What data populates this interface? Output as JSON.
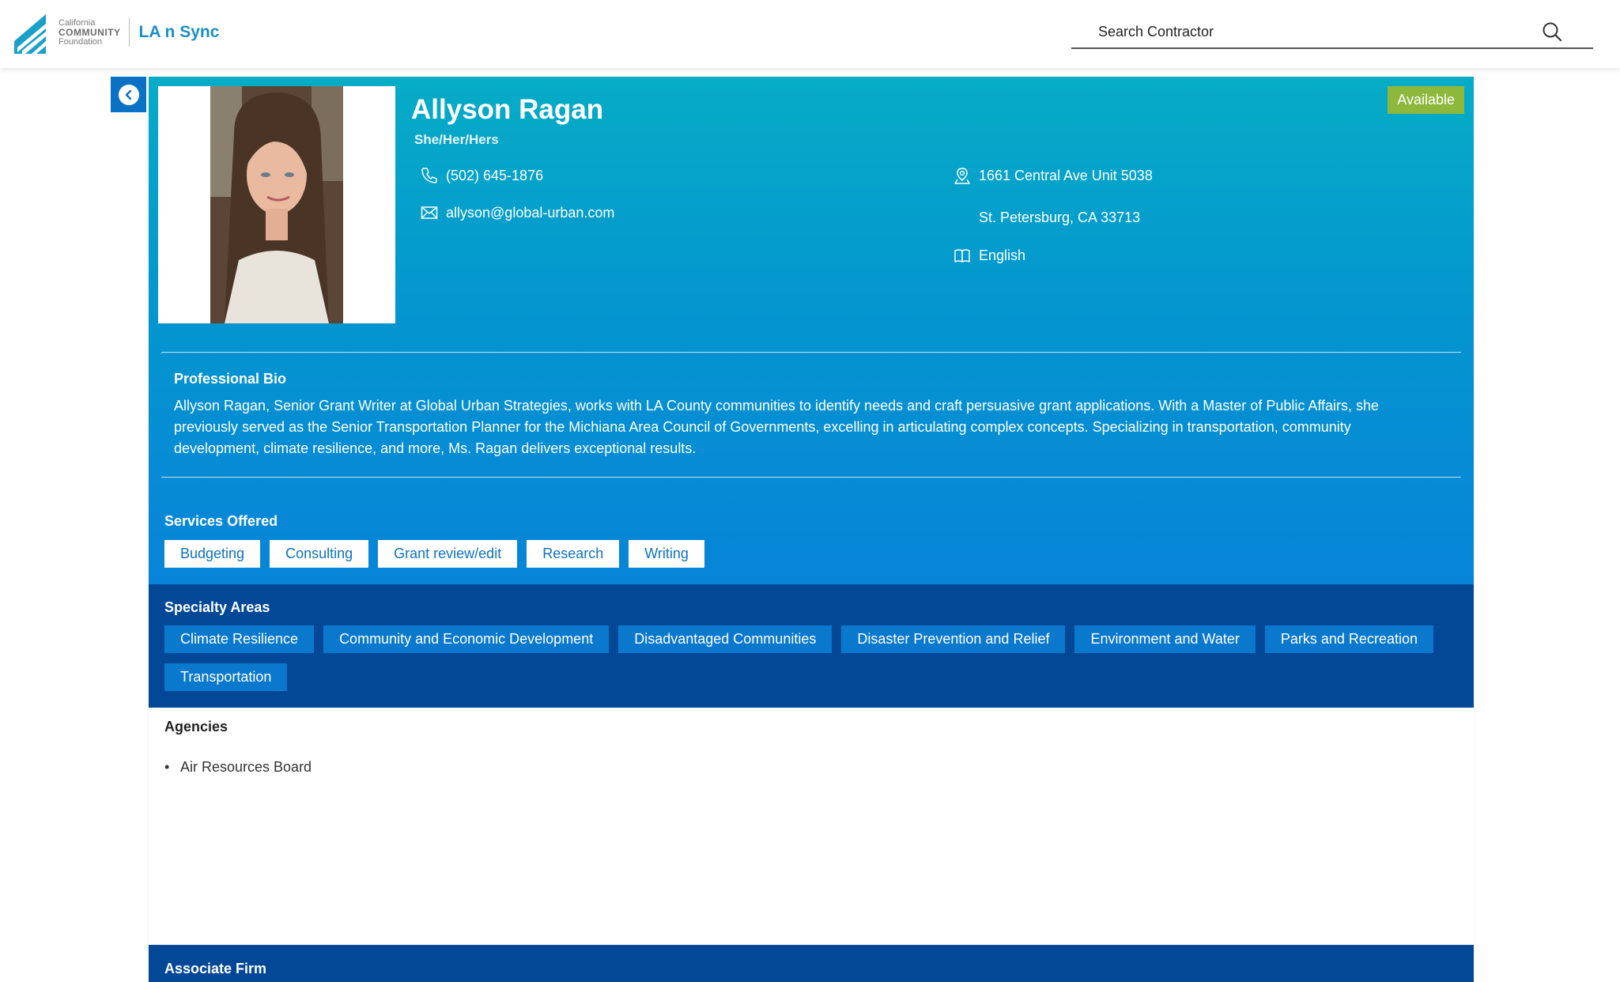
{
  "header": {
    "logo_line1": "California",
    "logo_line2": "COMMUNITY",
    "logo_line3": "Foundation",
    "app_name": "LA n Sync",
    "search_placeholder": "Search Contractor"
  },
  "profile": {
    "name": "Allyson Ragan",
    "pronouns": "She/Her/Hers",
    "status": "Available",
    "phone": "(502) 645-1876",
    "email": "allyson@global-urban.com",
    "address_line1": "1661 Central Ave Unit 5038",
    "address_line2": "St. Petersburg, CA 33713",
    "language": "English"
  },
  "bio": {
    "title": "Professional Bio",
    "text": "Allyson Ragan, Senior Grant Writer at Global Urban Strategies, works with LA County communities to identify needs and craft persuasive grant applications. With a Master of Public Affairs, she previously served as the Senior Transportation Planner for the Michiana Area Council of Governments, excelling in articulating complex concepts. Specializing in transportation, community development, climate resilience, and more, Ms. Ragan delivers exceptional results."
  },
  "services": {
    "title": "Services Offered",
    "items": [
      "Budgeting",
      "Consulting",
      "Grant review/edit",
      "Research",
      "Writing"
    ]
  },
  "specialty": {
    "title": "Specialty Areas",
    "items": [
      "Climate Resilience",
      "Community and Economic Development",
      "Disadvantaged Communities",
      "Disaster Prevention and Relief",
      "Environment and Water",
      "Parks and Recreation",
      "Transportation"
    ]
  },
  "agencies": {
    "title": "Agencies",
    "items": [
      "Air Resources Board"
    ]
  },
  "firm": {
    "title": "Associate Firm"
  },
  "icons": {
    "back": "chevron-left-icon",
    "search": "search-icon",
    "phone": "phone-icon",
    "email": "envelope-icon",
    "location": "location-pin-icon",
    "language": "book-icon"
  },
  "colors": {
    "hero_top": "#06acc6",
    "hero_bottom": "#0784d8",
    "dark_blue": "#034896",
    "tag_blue": "#0a78cd",
    "available": "#8db83b",
    "brand": "#1a8fc4"
  }
}
